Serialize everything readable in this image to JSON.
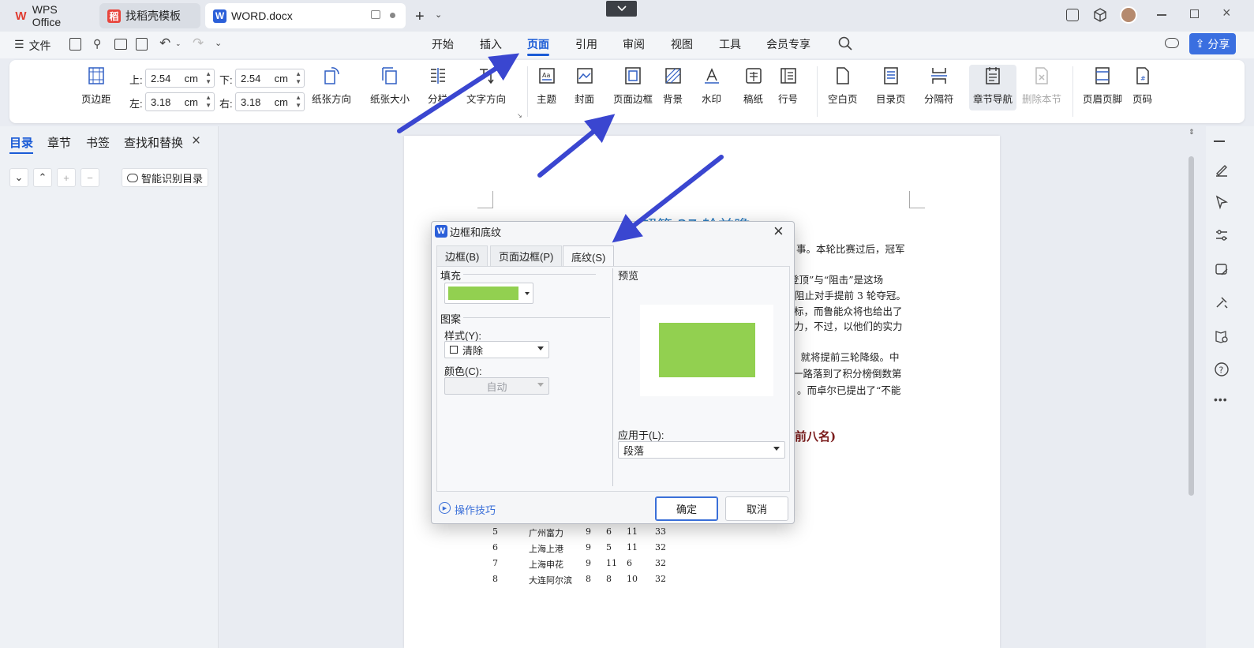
{
  "tabs": [
    {
      "label": "WPS Office"
    },
    {
      "label": "找稻壳模板"
    },
    {
      "label": "WORD.docx"
    }
  ],
  "menu": {
    "file_label": "文件",
    "tabs": [
      "开始",
      "插入",
      "页面",
      "引用",
      "审阅",
      "视图",
      "工具",
      "会员专享"
    ],
    "active_tab": "页面",
    "share_label": "分享"
  },
  "ribbon": {
    "margins_label": "页边距",
    "top_label": "上:",
    "top_value": "2.54",
    "bottom_label": "下:",
    "bottom_value": "2.54",
    "left_label": "左:",
    "left_value": "3.18",
    "right_label": "右:",
    "right_value": "3.18",
    "unit": "cm",
    "orientation": "纸张方向",
    "size": "纸张大小",
    "columns": "分栏",
    "text_direction": "文字方向",
    "theme": "主题",
    "cover": "封面",
    "page_border": "页面边框",
    "background": "背景",
    "watermark": "水印",
    "manuscript": "稿纸",
    "line_number": "行号",
    "blank_page": "空白页",
    "toc_page": "目录页",
    "separator": "分隔符",
    "chapter_nav": "章节导航",
    "delete_section": "删除本节",
    "header_footer": "页眉页脚",
    "page_number": "页码"
  },
  "left_panel": {
    "tabs": [
      "目录",
      "章节",
      "书签",
      "查找和替换"
    ],
    "smart_toc": "智能识别目录"
  },
  "document": {
    "title_partial": "超第 27 轮前瞻",
    "lines": [
      "事。本轮比赛过后，冠军",
      "登顶”与“阻击”是这场",
      "阻止对手提前 3 轮夺冠。",
      "标，而鲁能众将也给出了",
      "力，不过，以他们的实力",
      "，就将提前三轮降级。中",
      "一路落到了积分榜倒数第",
      "。而卓尔已提出了“不能"
    ],
    "subheading_partial": "前八名)",
    "table": [
      [
        "5",
        "广州富力",
        "9",
        "6",
        "11",
        "33"
      ],
      [
        "6",
        "上海上港",
        "9",
        "5",
        "11",
        "32"
      ],
      [
        "7",
        "上海申花",
        "9",
        "11",
        "6",
        "32"
      ],
      [
        "8",
        "大连阿尔滨",
        "8",
        "8",
        "10",
        "32"
      ]
    ]
  },
  "dialog": {
    "title": "边框和底纹",
    "tabs": [
      "边框(B)",
      "页面边框(P)",
      "底纹(S)"
    ],
    "fill_label": "填充",
    "fill_color": "#92d050",
    "pattern_label": "图案",
    "style_label": "样式(Y):",
    "style_value": "清除",
    "color_label": "颜色(C):",
    "color_value": "自动",
    "preview_label": "预览",
    "apply_label": "应用于(L):",
    "apply_value": "段落",
    "tips_label": "操作技巧",
    "ok_label": "确定",
    "cancel_label": "取消"
  },
  "colors": {
    "accent": "#1a5bd6",
    "arrow": "#3a46d0",
    "fill": "#92d050"
  }
}
